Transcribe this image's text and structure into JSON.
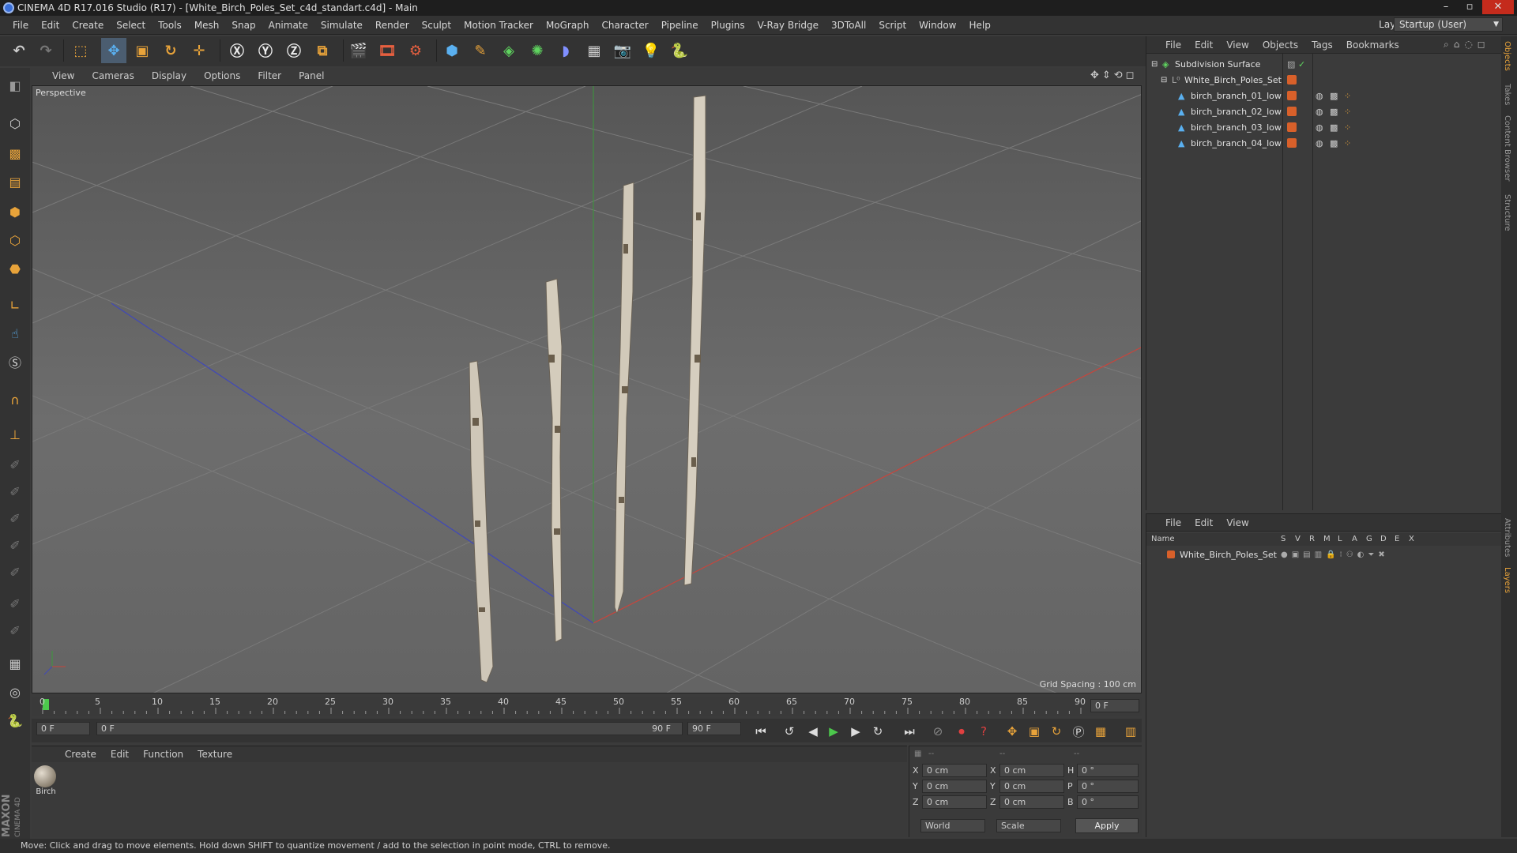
{
  "window": {
    "title": "CINEMA 4D R17.016 Studio (R17) - [White_Birch_Poles_Set_c4d_standart.c4d] - Main"
  },
  "menu": [
    "File",
    "Edit",
    "Create",
    "Select",
    "Tools",
    "Mesh",
    "Snap",
    "Animate",
    "Simulate",
    "Render",
    "Sculpt",
    "Motion Tracker",
    "MoGraph",
    "Character",
    "Pipeline",
    "Plugins",
    "V-Ray Bridge",
    "3DToAll",
    "Script",
    "Window",
    "Help"
  ],
  "layout": {
    "label": "Layout:",
    "value": "Startup (User)"
  },
  "viewport": {
    "menu": [
      "View",
      "Cameras",
      "Display",
      "Options",
      "Filter",
      "Panel"
    ],
    "camera_label": "Perspective",
    "grid_spacing": "Grid Spacing : 100 cm"
  },
  "timeline": {
    "ticks": [
      "0",
      "5",
      "10",
      "15",
      "20",
      "25",
      "30",
      "35",
      "40",
      "45",
      "50",
      "55",
      "60",
      "65",
      "70",
      "75",
      "80",
      "85",
      "90"
    ],
    "current_frame": "0 F",
    "start_field": "0 F",
    "range_start": "0 F",
    "range_end": "90 F",
    "end_field": "90 F"
  },
  "material_manager": {
    "menu": [
      "Create",
      "Edit",
      "Function",
      "Texture"
    ],
    "materials": [
      {
        "name": "Birch"
      }
    ]
  },
  "coordinates": {
    "headers": [
      "--",
      "--",
      "--"
    ],
    "rows": [
      {
        "a": "X",
        "av": "0 cm",
        "b": "X",
        "bv": "0 cm",
        "c": "H",
        "cv": "0 °"
      },
      {
        "a": "Y",
        "av": "0 cm",
        "b": "Y",
        "bv": "0 cm",
        "c": "P",
        "cv": "0 °"
      },
      {
        "a": "Z",
        "av": "0 cm",
        "b": "Z",
        "bv": "0 cm",
        "c": "B",
        "cv": "0 °"
      }
    ],
    "space": "World",
    "mode": "Scale",
    "apply": "Apply"
  },
  "object_manager": {
    "menu": [
      "File",
      "Edit",
      "View",
      "Objects",
      "Tags",
      "Bookmarks"
    ],
    "objects": [
      {
        "name": "Subdivision Surface",
        "level": 0
      },
      {
        "name": "White_Birch_Poles_Set",
        "level": 1
      },
      {
        "name": "birch_branch_01_low",
        "level": 2
      },
      {
        "name": "birch_branch_02_low",
        "level": 2
      },
      {
        "name": "birch_branch_03_low",
        "level": 2
      },
      {
        "name": "birch_branch_04_low",
        "level": 2
      }
    ]
  },
  "layer_manager": {
    "menu": [
      "File",
      "Edit",
      "View"
    ],
    "name_header": "Name",
    "columns": [
      "S",
      "V",
      "R",
      "M",
      "L",
      "A",
      "G",
      "D",
      "E",
      "X"
    ],
    "layers": [
      {
        "name": "White_Birch_Poles_Set"
      }
    ]
  },
  "side_tabs": [
    "Objects",
    "Takes",
    "Content Browser",
    "Structure",
    "Attributes",
    "Layers"
  ],
  "statusbar": {
    "text": "Move: Click and drag to move elements. Hold down SHIFT to quantize movement / add to the selection in point mode, CTRL to remove."
  },
  "branding": {
    "brand": "MAXON",
    "product": "CINEMA 4D"
  },
  "colors": {
    "accent_orange": "#e8a33a",
    "layer_orange": "#d8602a",
    "axis_x": "#c8453c",
    "axis_z": "#4048b8",
    "axis_y": "#3a9a3a"
  }
}
